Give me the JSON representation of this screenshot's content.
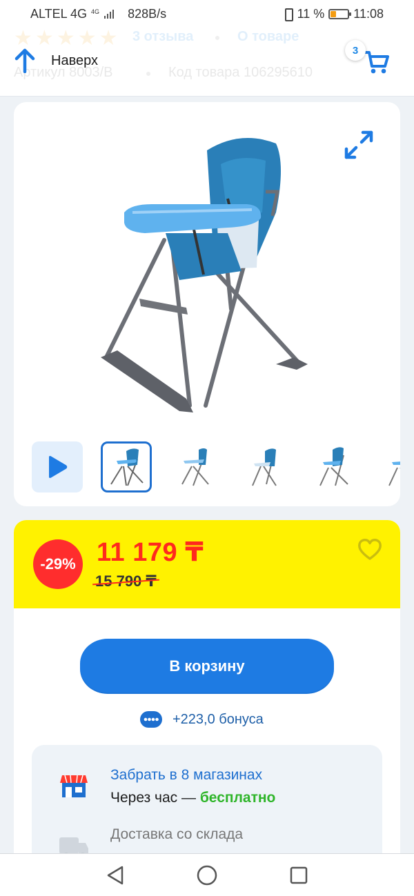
{
  "status_bar": {
    "carrier": "ALTEL 4G",
    "network_type": "4G",
    "speed": "828B/s",
    "battery_percent": "11 %",
    "battery_level": 0.11,
    "time": "11:08"
  },
  "header": {
    "back_up_label": "Наверх",
    "cart_count": "3",
    "ghost": {
      "reviews": "3 отзыва",
      "about": "О товаре",
      "article": "Артикул 8003/B",
      "product_code": "Код товара 106295610",
      "rating_stars": 5
    }
  },
  "gallery": {
    "thumbnail_count": 6,
    "active_thumbnail": 1
  },
  "price": {
    "discount": "-29%",
    "current": "11 179 ₸",
    "old": "15 790 ₸"
  },
  "actions": {
    "add_to_cart_label": "В корзину",
    "bonus_text": "+223,0 бонуса"
  },
  "delivery": {
    "pickup_title": "Забрать в 8 магазинах",
    "pickup_time": "Через час — ",
    "pickup_free": "бесплатно",
    "warehouse_title": "Доставка со склада"
  },
  "colors": {
    "accent_blue": "#1e7be3",
    "price_red": "#ff2a1d",
    "promo_yellow": "#fff200",
    "free_green": "#2fb52a"
  },
  "icons": {
    "back": "up-arrow-icon",
    "cart": "cart-icon",
    "expand": "expand-icon",
    "video": "play-icon",
    "favorite": "heart-icon",
    "bonus": "bonus-card-icon",
    "store": "store-icon",
    "warehouse": "truck-icon"
  }
}
